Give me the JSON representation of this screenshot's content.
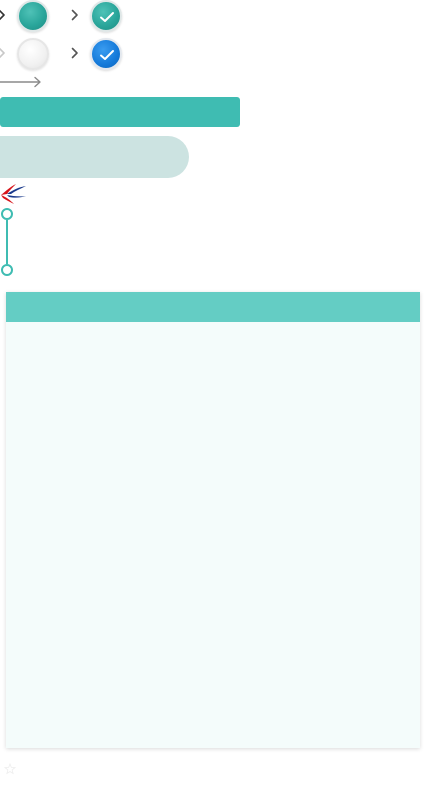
{
  "steps_row_1": {
    "items": [
      {
        "icon": "chevron-right-icon",
        "state": "pending"
      },
      {
        "icon": "step-circle-icon",
        "state": "active",
        "color": "#2aa69b"
      },
      {
        "icon": "chevron-right-icon",
        "state": "pending"
      },
      {
        "icon": "step-check-icon",
        "state": "done",
        "color": "#2aa69b"
      }
    ]
  },
  "steps_row_2": {
    "items": [
      {
        "icon": "chevron-right-icon",
        "state": "disabled"
      },
      {
        "icon": "step-circle-icon",
        "state": "inactive",
        "color": "#f1f1f1"
      },
      {
        "icon": "chevron-right-icon",
        "state": "pending"
      },
      {
        "icon": "step-check-icon",
        "state": "done",
        "color": "#1479d9"
      }
    ]
  },
  "arrow": {
    "icon": "arrow-right-icon",
    "color": "#8a8a8a"
  },
  "buttons": {
    "primary_label": "",
    "secondary_label": "",
    "primary_color": "#3fbcb2",
    "secondary_color": "#cce3e1"
  },
  "logo": {
    "icon": "airline-logo-icon",
    "colors": [
      "#d7141a",
      "#1b3a8c"
    ]
  },
  "timeline": {
    "color": "#3fbcb2",
    "nodes": 2
  },
  "panel": {
    "title": "",
    "header_color": "#64cdc4",
    "body_color": "#f4fcfb"
  },
  "footer": {
    "icon": "star-icon"
  }
}
